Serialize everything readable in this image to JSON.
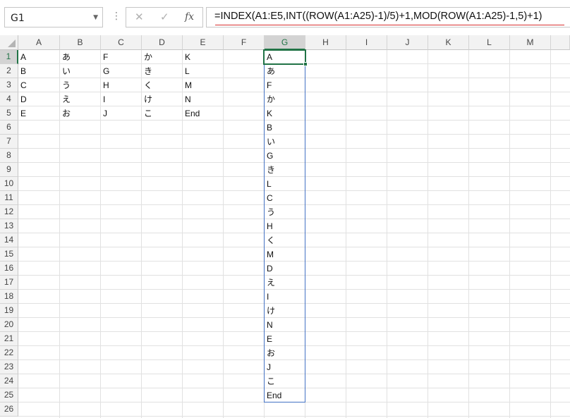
{
  "name_box": {
    "value": "G1"
  },
  "formula_bar": {
    "more_icon": "⋮",
    "cancel_icon": "✕",
    "enter_icon": "✓",
    "fx_label": "fx",
    "formula": "=INDEX(A1:E5,INT((ROW(A1:A25)-1)/5)+1,MOD(ROW(A1:A25)-1,5)+1)"
  },
  "columns": [
    "A",
    "B",
    "C",
    "D",
    "E",
    "F",
    "G",
    "H",
    "I",
    "J",
    "K",
    "L",
    "M"
  ],
  "selected_column": "G",
  "rows": [
    "1",
    "2",
    "3",
    "4",
    "5",
    "6",
    "7",
    "8",
    "9",
    "10",
    "11",
    "12",
    "13",
    "14",
    "15",
    "16",
    "17",
    "18",
    "19",
    "20",
    "21",
    "22",
    "23",
    "24",
    "25",
    "26"
  ],
  "selected_row": "1",
  "source_table": [
    [
      "A",
      "あ",
      "F",
      "か",
      "K"
    ],
    [
      "B",
      "い",
      "G",
      "き",
      "L"
    ],
    [
      "C",
      "う",
      "H",
      "く",
      "M"
    ],
    [
      "D",
      "え",
      "I",
      "け",
      "N"
    ],
    [
      "E",
      "お",
      "J",
      "こ",
      "End"
    ]
  ],
  "result_column_G": [
    "A",
    "あ",
    "F",
    "か",
    "K",
    "B",
    "い",
    "G",
    "き",
    "L",
    "C",
    "う",
    "H",
    "く",
    "M",
    "D",
    "え",
    "I",
    "け",
    "N",
    "E",
    "お",
    "J",
    "こ",
    "End"
  ],
  "colors": {
    "accent": "#217346",
    "spill_border": "#4472c4",
    "error_underline": "#d83131"
  }
}
